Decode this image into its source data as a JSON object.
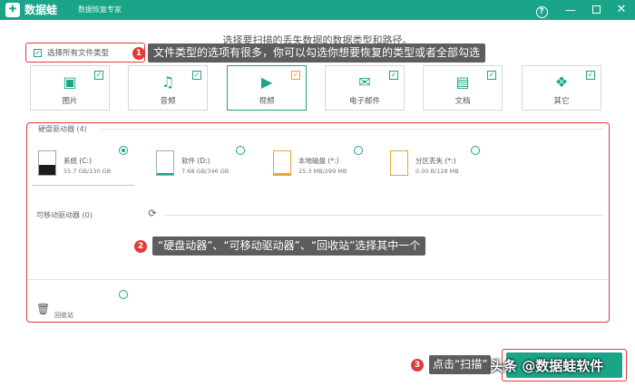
{
  "titlebar": {
    "logo_glyph": "✚",
    "app_name": "数据蛙",
    "app_subtitle": "数据恢复专家",
    "help_glyph": "?",
    "minimize_glyph": "—",
    "close_glyph": "✕"
  },
  "header": {
    "instruction": "选择要扫描的丢失数据的数据类型和路径。"
  },
  "select_all": {
    "label": "选择所有文件类型",
    "checked": true
  },
  "file_types": [
    {
      "label": "图片",
      "icon": "image-icon",
      "glyph": "▣",
      "checked": true
    },
    {
      "label": "音频",
      "icon": "music-icon",
      "glyph": "♫",
      "checked": true
    },
    {
      "label": "视频",
      "icon": "video-icon",
      "glyph": "▶",
      "checked": true,
      "active": true
    },
    {
      "label": "电子邮件",
      "icon": "email-icon",
      "glyph": "✉",
      "checked": true
    },
    {
      "label": "文档",
      "icon": "document-icon",
      "glyph": "▤",
      "checked": true
    },
    {
      "label": "其它",
      "icon": "other-icon",
      "glyph": "❖",
      "checked": true
    }
  ],
  "hard_drives": {
    "label": "硬盘驱动器 (4)",
    "drives": [
      {
        "name": "系统 (C:)",
        "size": "55.7 GB/130 GB",
        "selected": true,
        "fill_color": "#1c1c1c",
        "used_fraction": 0.43
      },
      {
        "name": "软件 (D:)",
        "size": "7.68 GB/346 GB",
        "selected": false,
        "fill_color": "#1aa589",
        "used_fraction": 0.02
      },
      {
        "name": "本地磁盘 (*:)",
        "size": "25.3 MB/299 MB",
        "selected": false,
        "fill_color": "#e8a33a",
        "used_fraction": 0.08
      },
      {
        "name": "分区丢失 (*:)",
        "size": "0.00  B/128 MB",
        "selected": false,
        "fill_color": "#e8a33a",
        "used_fraction": 0.0
      }
    ]
  },
  "removable": {
    "label": "可移动驱动器 (0)",
    "refresh_glyph": "⟳"
  },
  "recycle": {
    "label": "回收站",
    "glyph": "🗑"
  },
  "annotations": [
    {
      "num": "1",
      "text": "文件类型的选项有很多，你可以勾选你想要恢复的类型或者全部勾选"
    },
    {
      "num": "2",
      "text": "“硬盘动器”、“可移动驱动器”、“回收站”选择其中一个"
    },
    {
      "num": "3",
      "text": "点击“扫描”"
    }
  ],
  "watermark": {
    "text": "头条 @数据蛙软件"
  },
  "colors": {
    "accent": "#1aa589",
    "highlight": "#e23b3b",
    "annotation_bg": "#5d5d5d"
  }
}
